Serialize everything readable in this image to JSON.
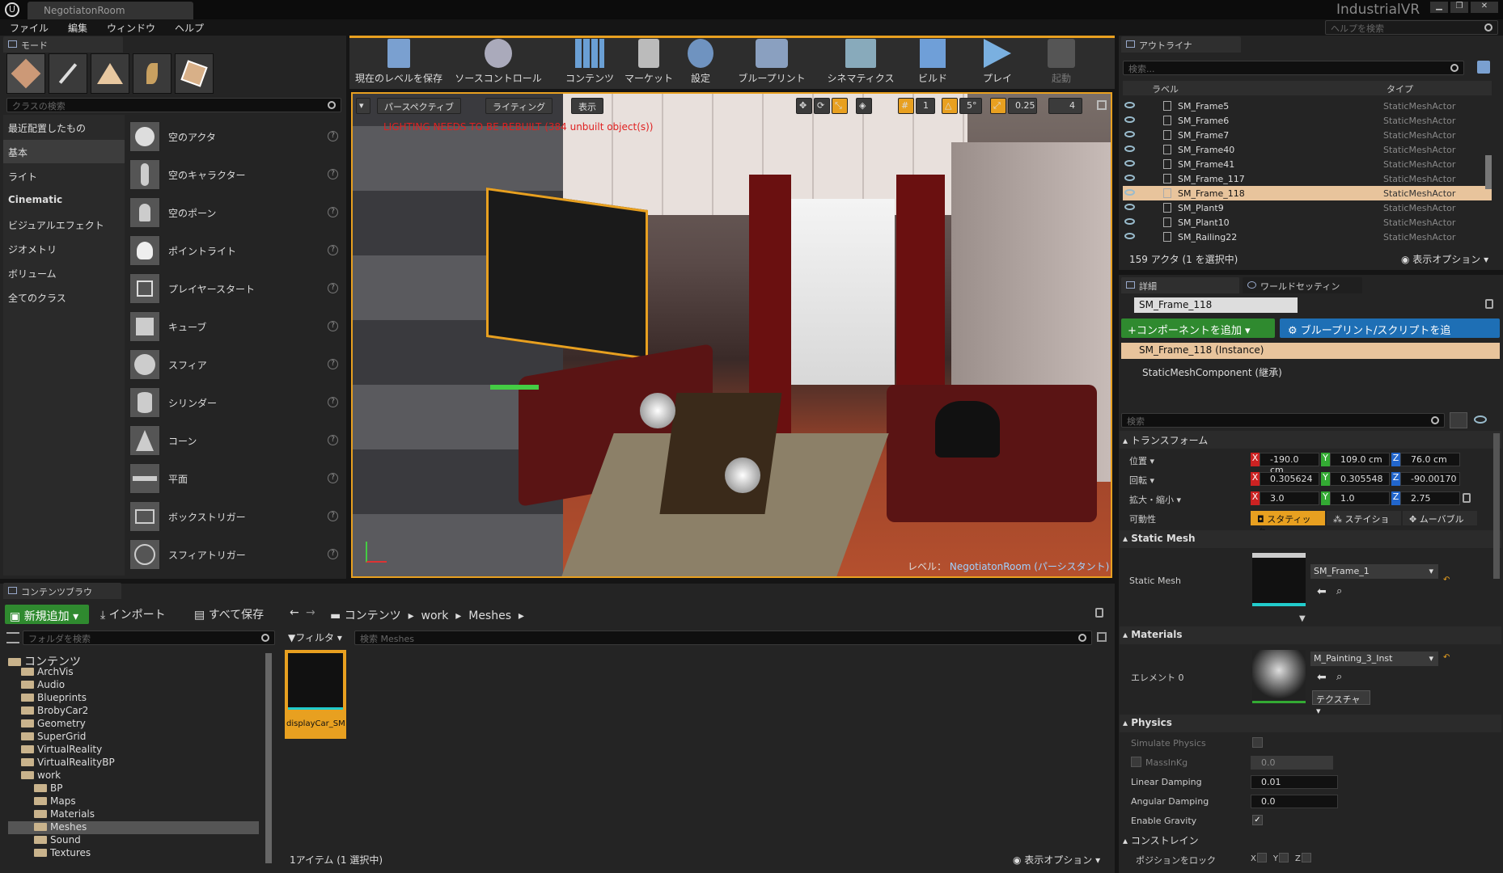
{
  "window": {
    "doc_tab": "NegotiatonRoom",
    "project": "IndustrialVR",
    "help_search": "ヘルプを検索"
  },
  "menu": [
    "ファイル",
    "編集",
    "ウィンドウ",
    "ヘルプ"
  ],
  "modes": {
    "tab": "モード",
    "search_placeholder": "クラスの検索",
    "categories": [
      "最近配置したもの",
      "基本",
      "ライト",
      "Cinematic",
      "ビジュアルエフェクト",
      "ジオメトリ",
      "ボリューム",
      "全てのクラス"
    ],
    "items": [
      "空のアクタ",
      "空のキャラクター",
      "空のポーン",
      "ポイントライト",
      "プレイヤースタート",
      "キューブ",
      "スフィア",
      "シリンダー",
      "コーン",
      "平面",
      "ボックストリガー",
      "スフィアトリガー"
    ],
    "help": "?"
  },
  "toolbar": [
    "現在のレベルを保存",
    "ソースコントロール",
    "コンテンツ",
    "マーケット",
    "設定",
    "ブループリント",
    "シネマティクス",
    "ビルド",
    "プレイ",
    "起動"
  ],
  "viewport": {
    "perspective": "パースペクティブ",
    "lighting": "ライティング",
    "show": "表示",
    "warning": "LIGHTING NEEDS TO BE REBUILT (384 unbuilt object(s))",
    "angle": "5°",
    "scale": "0.25",
    "speed": "4",
    "grid": "1",
    "level_label": "レベル：",
    "level_name": "NegotiatonRoom (パーシスタント)"
  },
  "outliner": {
    "tab": "アウトライナ",
    "search_placeholder": "検索...",
    "col_label": "ラベル",
    "col_type": "タイプ",
    "rows": [
      {
        "label": "SM_Frame5",
        "type": "StaticMeshActor"
      },
      {
        "label": "SM_Frame6",
        "type": "StaticMeshActor"
      },
      {
        "label": "SM_Frame7",
        "type": "StaticMeshActor"
      },
      {
        "label": "SM_Frame40",
        "type": "StaticMeshActor"
      },
      {
        "label": "SM_Frame41",
        "type": "StaticMeshActor"
      },
      {
        "label": "SM_Frame_117",
        "type": "StaticMeshActor"
      },
      {
        "label": "SM_Frame_118",
        "type": "StaticMeshActor"
      },
      {
        "label": "SM_Plant9",
        "type": "StaticMeshActor"
      },
      {
        "label": "SM_Plant10",
        "type": "StaticMeshActor"
      },
      {
        "label": "SM_Railing22",
        "type": "StaticMeshActor"
      }
    ],
    "count": "159 アクタ (1 を選択中)",
    "view_options": "表示オプション"
  },
  "details": {
    "tab1": "詳細",
    "tab2": "ワールドセッティン",
    "name": "SM_Frame_118",
    "add_component": "+コンポーネントを追加",
    "blueprint": "ブループリント/スクリプトを追",
    "instance": "SM_Frame_118 (Instance)",
    "component": "StaticMeshComponent (継承)",
    "search_placeholder": "検索",
    "transform": {
      "title": "トランスフォーム",
      "location": "位置",
      "rotation": "回転",
      "scale": "拡大・縮小",
      "mobility": "可動性",
      "loc": [
        "-190.0 cm",
        "109.0 cm",
        "76.0 cm"
      ],
      "rot": [
        "0.305624",
        "0.305548",
        "-90.00170"
      ],
      "scl": [
        "3.0",
        "1.0",
        "2.75"
      ],
      "mob": [
        "スタティック",
        "ステイショ",
        "ムーバブル"
      ],
      "axes": [
        "X",
        "Y",
        "Z"
      ]
    },
    "static_mesh": {
      "title": "Static Mesh",
      "label": "Static Mesh",
      "value": "SM_Frame_1"
    },
    "materials": {
      "title": "Materials",
      "element": "エレメント 0",
      "value": "M_Painting_3_Inst",
      "texture": "テクスチャ"
    },
    "physics": {
      "title": "Physics",
      "simulate": "Simulate Physics",
      "mass": "MassInKg",
      "mass_val": "0.0",
      "linear": "Linear Damping",
      "linear_val": "0.01",
      "angular": "Angular Damping",
      "angular_val": "0.0",
      "gravity": "Enable Gravity",
      "constraint": "コンストレイン",
      "lock_pos": "ポジションをロック"
    }
  },
  "content": {
    "tab": "コンテンツブラウ",
    "add_new": "新規追加",
    "import": "インポート",
    "save_all": "すべて保存",
    "path": [
      "コンテンツ",
      "work",
      "Meshes"
    ],
    "folder_search": "フォルダを検索",
    "filter": "フィルタ",
    "search_placeholder": "検索 Meshes",
    "tree": [
      "コンテンツ",
      "ArchVis",
      "Audio",
      "Blueprints",
      "BrobyCar2",
      "Geometry",
      "SuperGrid",
      "VirtualReality",
      "VirtualRealityBP",
      "work",
      "BP",
      "Maps",
      "Materials",
      "Meshes",
      "Sound",
      "Textures"
    ],
    "asset": "displayCar_SM",
    "status": "1アイテム (1 選択中)",
    "view_options": "表示オプション"
  },
  "colors": {
    "accent": "#e8a020",
    "selection": "#e8c49c",
    "green": "#2f8a2f",
    "blue": "#1e6fb5"
  }
}
